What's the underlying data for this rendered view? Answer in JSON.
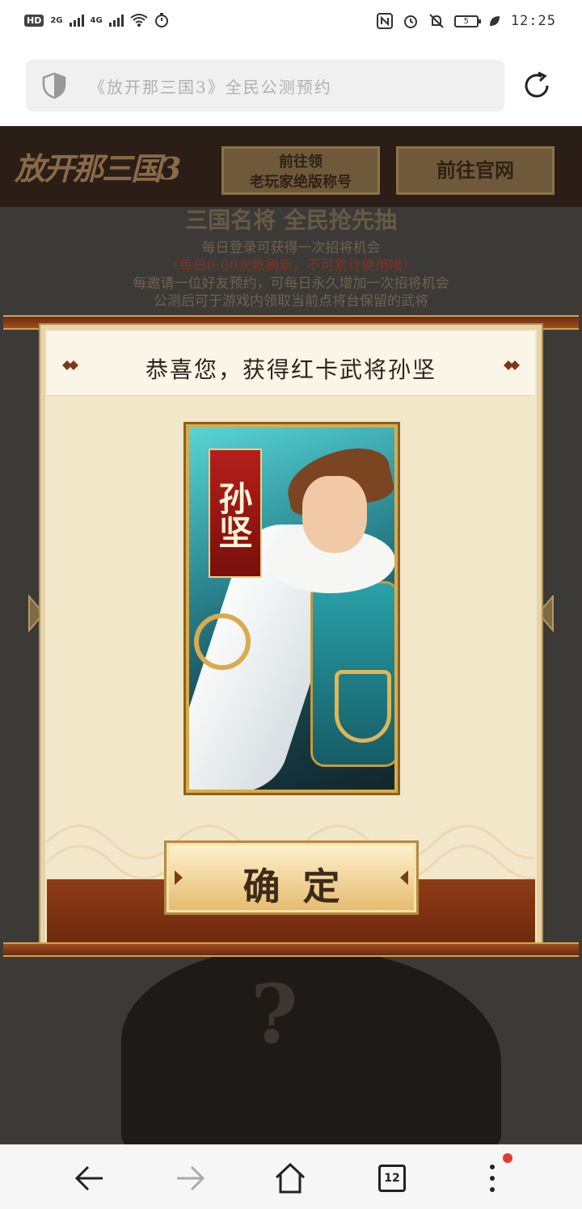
{
  "status_bar": {
    "hd": "HD",
    "sim_2g": "2G",
    "sim_4g": "4G",
    "battery": "5",
    "time": "12:25"
  },
  "address_bar": {
    "url_text": "《放开那三国3》全民公测预约"
  },
  "page": {
    "logo": "放开那三国3",
    "button_claim_title": "前往领\n老玩家绝版称号",
    "button_official": "前往官网",
    "banner_title": "三国名将 全民抢先抽",
    "info_lines": [
      "每日登录可获得一次招将机会",
      "（每日0:00次数刷新，不可累计使用哦）",
      "每邀请一位好友预约，可每日永久增加一次招将机会",
      "公测后可于游戏内领取当前点将台保留的武将"
    ]
  },
  "modal": {
    "title": "恭喜您，获得红卡武将孙坚",
    "hero_name": "孙坚",
    "confirm_label": "确定"
  },
  "nav": {
    "tab_count": "12"
  },
  "colors": {
    "modal_bg": "#f3e7c9",
    "frame_brown": "#8e3b15",
    "gold": "#d8ab4c",
    "card_red": "#b51f1a",
    "notification_dot": "#e53935"
  },
  "icons": {
    "shield": "shield-icon",
    "reload": "reload-icon",
    "back": "back-arrow-icon",
    "forward": "forward-arrow-icon",
    "home": "home-icon",
    "tabs": "tabs-icon",
    "menu": "more-vert-icon"
  }
}
